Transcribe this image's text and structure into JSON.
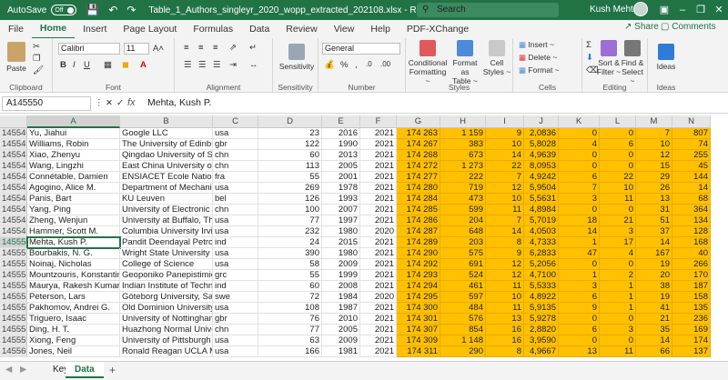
{
  "titlebar": {
    "autosave_label": "AutoSave",
    "autosave_state": "Off",
    "filename": "Table_1_Authors_singleyr_2020_wopp_extracted_202108.xlsx",
    "mode": " -  Read-Only  -  Excel",
    "search_placeholder": "Search",
    "user_name": "Kush Mehta"
  },
  "menu": {
    "tabs": [
      "File",
      "Home",
      "Insert",
      "Page Layout",
      "Formulas",
      "Data",
      "Review",
      "View",
      "Help",
      "PDF-XChange"
    ],
    "share": "Share",
    "comments": "Comments"
  },
  "ribbon": {
    "clipboard": {
      "paste": "Paste",
      "label": "Clipboard"
    },
    "font": {
      "name": "Calibri",
      "size": "11",
      "label": "Font"
    },
    "alignment": {
      "label": "Alignment"
    },
    "sensitivity": {
      "button": "Sensitivity",
      "label": "Sensitivity"
    },
    "number": {
      "format": "General",
      "label": "Number"
    },
    "styles": {
      "cond": "Conditional",
      "cond2": "Formatting ~",
      "fmt": "Format as",
      "fmt2": "Table ~",
      "cell": "Cell",
      "cell2": "Styles ~",
      "label": "Styles"
    },
    "cells": {
      "insert": "Insert ~",
      "delete": "Delete ~",
      "format": "Format ~",
      "label": "Cells"
    },
    "editing": {
      "sort": "Sort &",
      "sort2": "Filter ~",
      "find": "Find &",
      "find2": "Select ~",
      "label": "Editing"
    },
    "ideas": {
      "button": "Ideas",
      "label": "Ideas"
    }
  },
  "formula_bar": {
    "name_box": "A145550",
    "fx": "fx",
    "value": "Mehta, Kush P."
  },
  "columns": [
    "A",
    "B",
    "C",
    "D",
    "E",
    "F",
    "G",
    "H",
    "I",
    "J",
    "K",
    "L",
    "M",
    "N"
  ],
  "rows": [
    [
      "145540",
      "Yu, Jiahui",
      "Google LLC",
      "usa",
      "23",
      "2016",
      "2021",
      "174 263",
      "1 159",
      "9",
      "2,0836",
      "0",
      "0",
      "7",
      "807"
    ],
    [
      "145541",
      "Williams, Robin",
      "The University of Edinburgh",
      "gbr",
      "122",
      "1990",
      "2021",
      "174 267",
      "383",
      "10",
      "5,8028",
      "4",
      "6",
      "10",
      "74"
    ],
    [
      "145542",
      "Xiao, Zhenyu",
      "Qingdao University of Science",
      "chn",
      "60",
      "2013",
      "2021",
      "174 268",
      "673",
      "14",
      "4,9639",
      "0",
      "0",
      "12",
      "255"
    ],
    [
      "145543",
      "Wang, Lingzhi",
      "East China University of Sc",
      "chn",
      "113",
      "2005",
      "2021",
      "174 272",
      "1 273",
      "22",
      "8,0953",
      "0",
      "0",
      "15",
      "45"
    ],
    [
      "145544",
      "Connétable, Damien",
      "ENSIACET Ecole Nationale",
      "fra",
      "55",
      "2001",
      "2021",
      "174 277",
      "222",
      "7",
      "4,9242",
      "6",
      "22",
      "29",
      "144"
    ],
    [
      "145545",
      "Agogino, Alice M.",
      "Department of Mechanical",
      "usa",
      "269",
      "1978",
      "2021",
      "174 280",
      "719",
      "12",
      "5,9504",
      "7",
      "10",
      "26",
      "14"
    ],
    [
      "145546",
      "Panis, Bart",
      "KU Leuven",
      "bel",
      "126",
      "1993",
      "2021",
      "174 284",
      "473",
      "10",
      "5,5631",
      "3",
      "11",
      "13",
      "68"
    ],
    [
      "145547",
      "Yang, Ping",
      "University of Electronic Sc",
      "chn",
      "100",
      "2007",
      "2021",
      "174 285",
      "599",
      "11",
      "4,8984",
      "0",
      "0",
      "31",
      "364"
    ],
    [
      "145548",
      "Zheng, Wenjun",
      "University at Buffalo, The S",
      "usa",
      "77",
      "1997",
      "2021",
      "174 286",
      "204",
      "7",
      "5,7019",
      "18",
      "21",
      "51",
      "134"
    ],
    [
      "145549",
      "Hammer, Scott M.",
      "Columbia University Irving",
      "usa",
      "232",
      "1980",
      "2020",
      "174 287",
      "648",
      "14",
      "4,0503",
      "14",
      "3",
      "37",
      "128"
    ],
    [
      "145550",
      "Mehta, Kush P.",
      "Pandit Deendayal Petroleum",
      "ind",
      "24",
      "2015",
      "2021",
      "174 289",
      "203",
      "8",
      "4,7333",
      "1",
      "17",
      "14",
      "168"
    ],
    [
      "145551",
      "Bourbakis, N. G.",
      "Wright State University",
      "usa",
      "390",
      "1980",
      "2021",
      "174 290",
      "575",
      "9",
      "6,2833",
      "47",
      "4",
      "167",
      "40"
    ],
    [
      "145552",
      "Noinaj, Nicholas",
      "College of Science",
      "usa",
      "58",
      "2009",
      "2021",
      "174 292",
      "691",
      "12",
      "5,2056",
      "0",
      "0",
      "19",
      "266"
    ],
    [
      "145553",
      "Mountzouris, Konstantinos",
      "Geoponiko Panepistimion",
      "grc",
      "55",
      "1999",
      "2021",
      "174 293",
      "524",
      "12",
      "4,7100",
      "1",
      "2",
      "20",
      "170"
    ],
    [
      "145554",
      "Maurya, Rakesh Kumar",
      "Indian Institute of Technology",
      "ind",
      "60",
      "2008",
      "2021",
      "174 294",
      "461",
      "11",
      "5,5333",
      "3",
      "1",
      "38",
      "187"
    ],
    [
      "145555",
      "Peterson, Lars",
      "Göteborg University, Sahlgrenska",
      "swe",
      "72",
      "1984",
      "2020",
      "174 295",
      "597",
      "10",
      "4,8922",
      "6",
      "1",
      "19",
      "158"
    ],
    [
      "145556",
      "Pakhomov, Andrei G.",
      "Old Dominion University",
      "usa",
      "108",
      "1987",
      "2021",
      "174 300",
      "484",
      "11",
      "5,9135",
      "9",
      "1",
      "41",
      "135"
    ],
    [
      "145557",
      "Triguero, Isaac",
      "University of Nottingham",
      "gbr",
      "76",
      "2010",
      "2021",
      "174 301",
      "576",
      "13",
      "5,9278",
      "0",
      "0",
      "21",
      "236"
    ],
    [
      "145558",
      "Ding, H. T.",
      "Huazhong Normal University",
      "chn",
      "77",
      "2005",
      "2021",
      "174 307",
      "854",
      "16",
      "2,8820",
      "6",
      "3",
      "35",
      "169"
    ],
    [
      "145559",
      "Xiong, Feng",
      "University of Pittsburgh",
      "usa",
      "63",
      "2009",
      "2021",
      "174 309",
      "1 148",
      "16",
      "3,9590",
      "0",
      "0",
      "14",
      "174"
    ],
    [
      "145560",
      "Jones, Neil",
      "Ronald Reagan UCLA Medical",
      "usa",
      "166",
      "1981",
      "2021",
      "174 311",
      "290",
      "8",
      "4,9667",
      "13",
      "11",
      "66",
      "137"
    ]
  ],
  "sheets": {
    "tabs": [
      "Key",
      "Data"
    ],
    "active": "Data",
    "add": "+"
  },
  "colors": {
    "excel_green": "#217346",
    "highlight": "#ffc000"
  }
}
